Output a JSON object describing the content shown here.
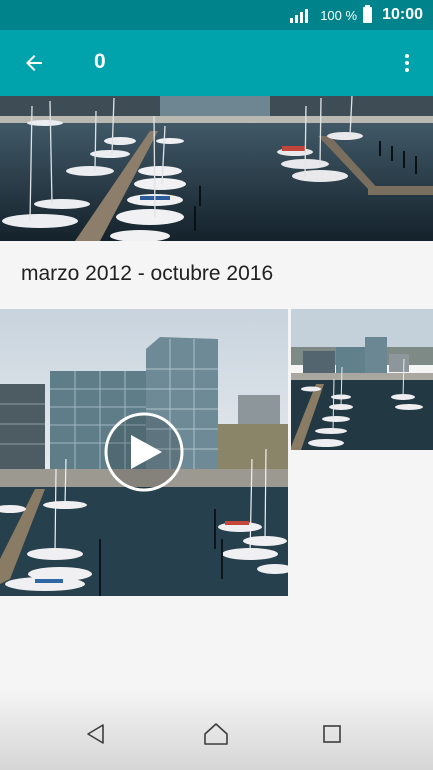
{
  "status_bar": {
    "battery_percent": "100 %",
    "time": "10:00",
    "icons": [
      "signal-icon",
      "battery-icon"
    ]
  },
  "app_bar": {
    "title": "0",
    "icons": [
      "back-arrow-icon",
      "more-vert-icon"
    ]
  },
  "gallery": {
    "section_header": "marzo 2012 - octubre 2016",
    "items": [
      {
        "type": "photo",
        "name": "marina-hero-photo"
      },
      {
        "type": "video",
        "name": "marina-video-thumbnail"
      },
      {
        "type": "photo",
        "name": "marina-photo-thumbnail"
      }
    ]
  },
  "nav_bar": {
    "icons": [
      "back-triangle-icon",
      "home-icon",
      "recents-icon"
    ]
  },
  "colors": {
    "status_bar": "#00838a",
    "app_bar": "#00a2ab",
    "background": "#f5f5f5"
  }
}
